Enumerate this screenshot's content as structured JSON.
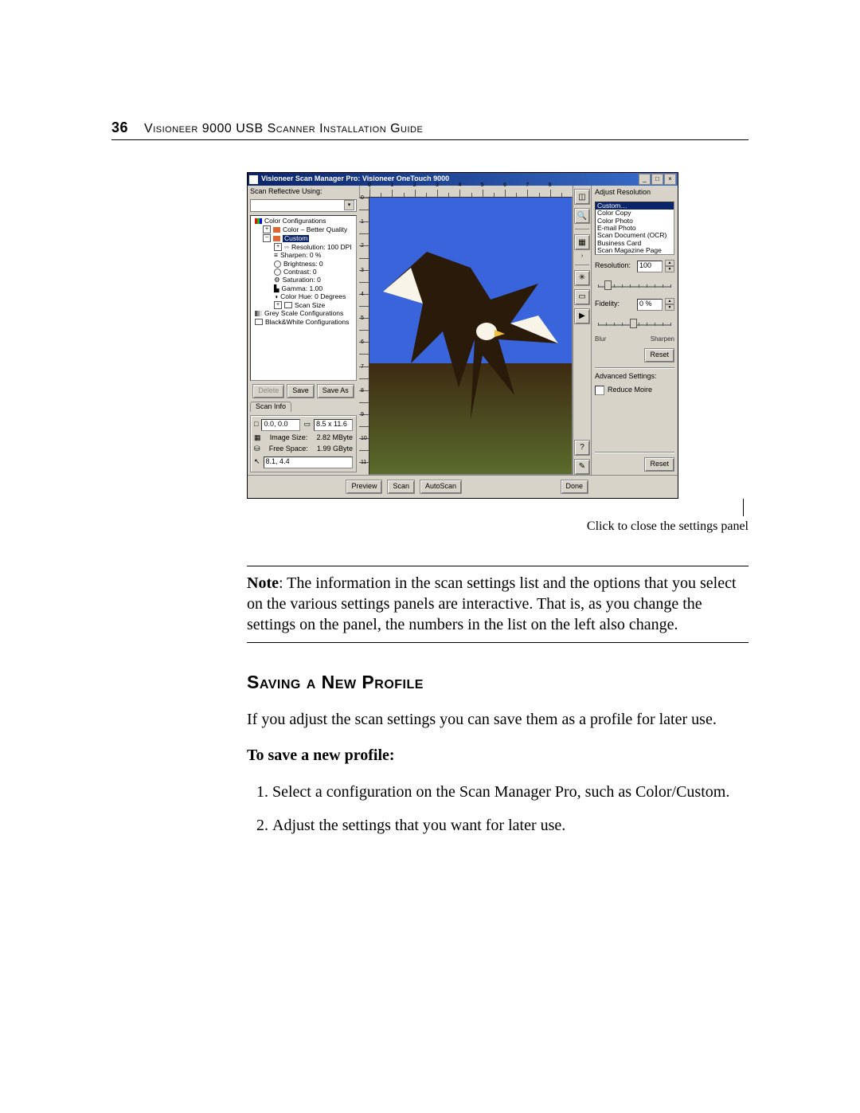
{
  "header": {
    "page_number": "36",
    "doc_title": "Visioneer 9000 USB Scanner Installation Guide"
  },
  "screenshot": {
    "titlebar": "Visioneer Scan Manager Pro: Visioneer OneTouch 9000",
    "win_buttons": {
      "min": "_",
      "max": "□",
      "close": "×"
    },
    "left": {
      "scan_mode_label": "Scan Reflective Using:",
      "tree": {
        "color_conf": "Color Configurations",
        "better_quality": "Color – Better Quality",
        "custom": "Custom",
        "resolution_item": "Resolution: 100 DPI",
        "sharpen": "Sharpen: 0 %",
        "brightness": "Brightness: 0",
        "contrast": "Contrast: 0",
        "saturation": "Saturation: 0",
        "gamma": "Gamma: 1.00",
        "colorhue": "Color Hue: 0 Degrees",
        "scan_size": "Scan Size",
        "gray_conf": "Grey Scale Configurations",
        "bw_conf": "Black&White Configurations"
      },
      "buttons": {
        "delete": "Delete",
        "save": "Save",
        "saveas": "Save As"
      },
      "tab": "Scan Info",
      "info": {
        "coords": "0.0, 0.0",
        "dims": "8.5 x 11.6",
        "img_label": "Image Size:",
        "img_value": "2.82 MByte",
        "free_label": "Free Space:",
        "free_value": "1.99 GByte",
        "pointer": "8.1, 4.4"
      }
    },
    "right": {
      "title": "Adjust Resolution",
      "presets": [
        "Custom…",
        "Color Copy",
        "Color Photo",
        "E-mail Photo",
        "Scan Document (OCR)",
        "Business Card",
        "Scan Magazine Page"
      ],
      "resolution_label": "Resolution:",
      "resolution_value": "100",
      "fidelity_label": "Fidelity:",
      "fidelity_value": "0 %",
      "blur_label": "Blur",
      "sharpen_label": "Sharpen",
      "reset": "Reset",
      "adv_label": "Advanced Settings:",
      "reduce_moire": "Reduce Moire",
      "reset2": "Reset"
    },
    "bottom": {
      "preview": "Preview",
      "scan": "Scan",
      "autoscan": "AutoScan",
      "done": "Done"
    },
    "tools": {
      "crop": "crop-icon",
      "zoom": "zoom-icon",
      "grid": "grid-icon",
      "arrow": "arrow-icon",
      "rotate": "rotate-icon",
      "rect": "rect-icon",
      "video": "video-icon",
      "help": "help-icon",
      "new": "new-icon"
    }
  },
  "callout": "Click to close the settings panel",
  "note": {
    "bold": "Note",
    "text": ":  The information in the scan settings list and the options that you select on the various settings panels are interactive. That is, as you change the settings on the panel, the numbers in the list on the left also change."
  },
  "section_title": "Saving a New Profile",
  "intro": "If you adjust the scan settings you can save them as a profile for later use.",
  "subhead": "To save a new profile:",
  "steps": [
    "Select a configuration on the Scan Manager Pro, such as Color/Custom.",
    "Adjust the settings that you want for later use."
  ]
}
